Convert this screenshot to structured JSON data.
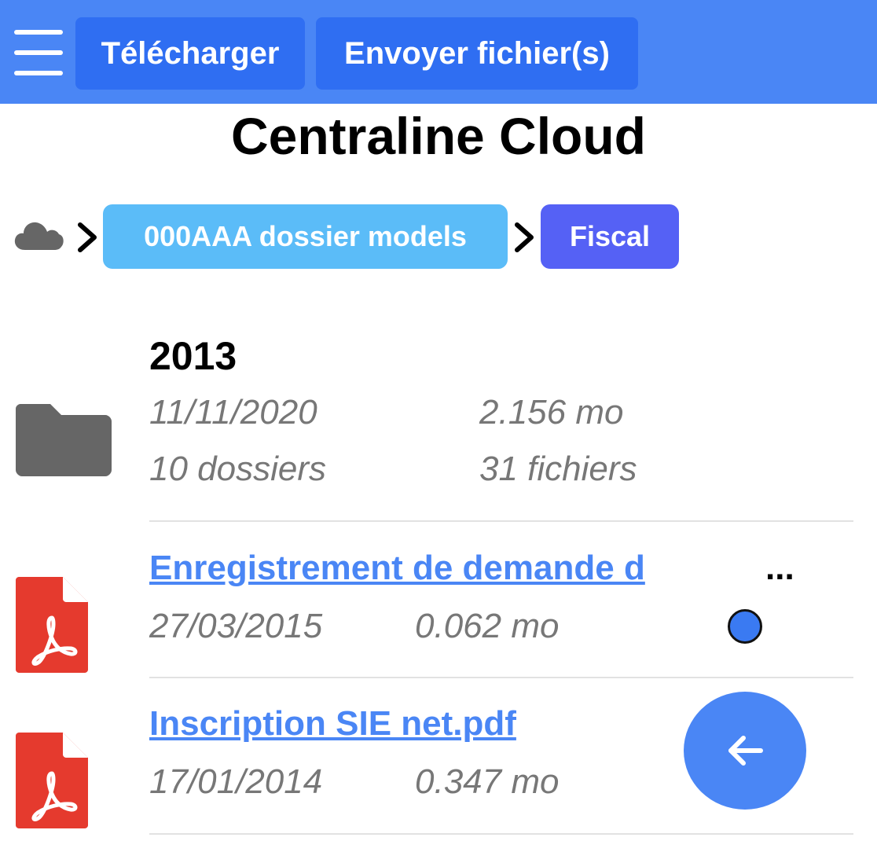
{
  "toolbar": {
    "download_label": "Télécharger",
    "upload_label": "Envoyer fichier(s)"
  },
  "app": {
    "title": "Centraline Cloud"
  },
  "breadcrumb": {
    "root_icon": "cloud-icon",
    "items": [
      {
        "label": "000AAA dossier models",
        "color": "#5bbcf8"
      },
      {
        "label": "Fiscal",
        "color": "#5561f5"
      }
    ]
  },
  "folder": {
    "name": "2013",
    "date": "11/11/2020",
    "size": "2.156 mo",
    "folders": "10 dossiers",
    "files": "31 fichiers",
    "icon": "folder-icon"
  },
  "files": [
    {
      "name": "Enregistrement de demande d",
      "ellipsis": "...",
      "date": "27/03/2015",
      "size": "0.062 mo",
      "icon": "pdf-icon",
      "status": "blue-dot"
    },
    {
      "name": "Inscription SIE net.pdf",
      "date": "17/01/2014",
      "size": "0.347 mo",
      "icon": "pdf-icon"
    }
  ],
  "colors": {
    "topbar": "#4a86f5",
    "button": "#2f6ef2",
    "link": "#4a86f5",
    "pdf": "#e53a2e",
    "folder": "#666666"
  }
}
